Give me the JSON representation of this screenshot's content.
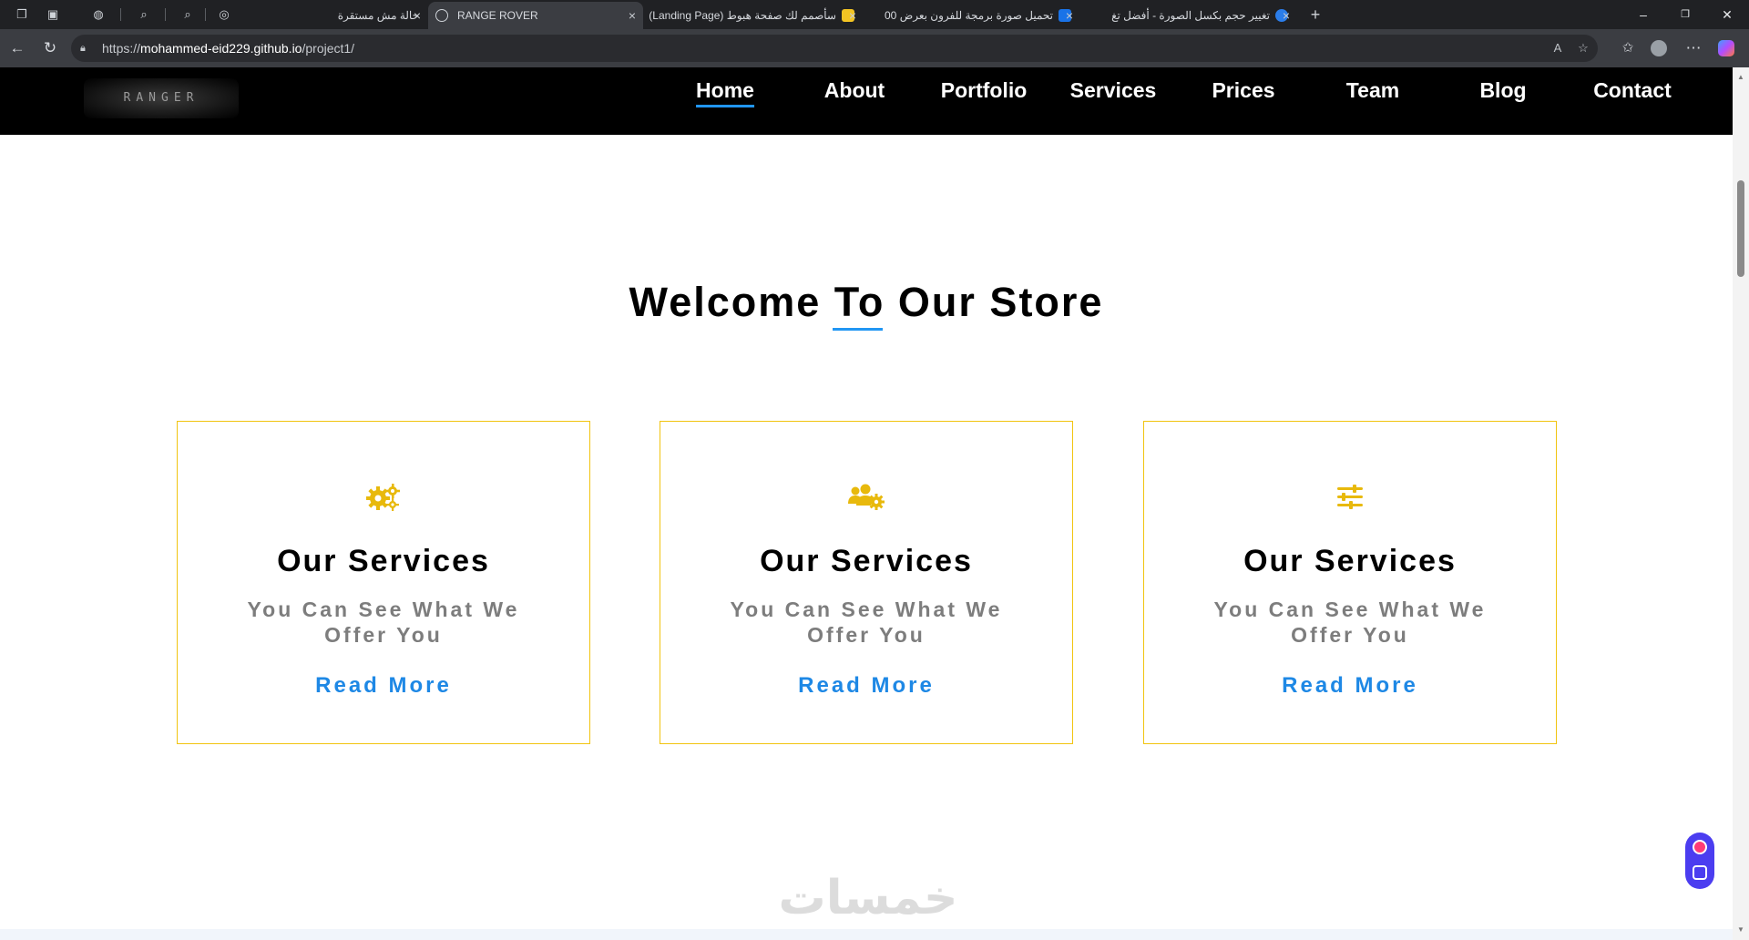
{
  "browser": {
    "tabs": [
      {
        "title": "حالة مش مستقرة",
        "active": false
      },
      {
        "title": "RANGE ROVER",
        "active": true
      },
      {
        "title": "سأصمم لك صفحة هبوط (Landing Page)",
        "active": false
      },
      {
        "title": "تحميل صورة برمجة للفرون بعرض 00",
        "active": false
      },
      {
        "title": "تغيير حجم بكسل الصورة - أفضل تغ",
        "active": false
      }
    ],
    "url_prefix": "https://",
    "url_host": "mohammed-eid229.github.io",
    "url_path": "/project1/"
  },
  "site": {
    "logo_text": "RANGER",
    "nav": [
      "Home",
      "About",
      "Portfolio",
      "Services",
      "Prices",
      "Team",
      "Blog",
      "Contact"
    ],
    "active_nav": "Home"
  },
  "welcome": {
    "before": "Welcome ",
    "underlined": "To",
    "after": " Our Store"
  },
  "cards": [
    {
      "icon": "gears-icon",
      "title": "Our Services",
      "text": "You Can See What We Offer You",
      "link": "Read More"
    },
    {
      "icon": "users-cog-icon",
      "title": "Our Services",
      "text": "You Can See What We Offer You",
      "link": "Read More"
    },
    {
      "icon": "sliders-icon",
      "title": "Our Services",
      "text": "You Can See What We Offer You",
      "link": "Read More"
    }
  ],
  "watermark": "خمسات",
  "colors": {
    "accent_blue": "#2196f3",
    "card_border": "#f1c40f",
    "icon_yellow": "#e8b90c",
    "link_blue": "#1e88e5",
    "nav_bg": "#000000"
  }
}
